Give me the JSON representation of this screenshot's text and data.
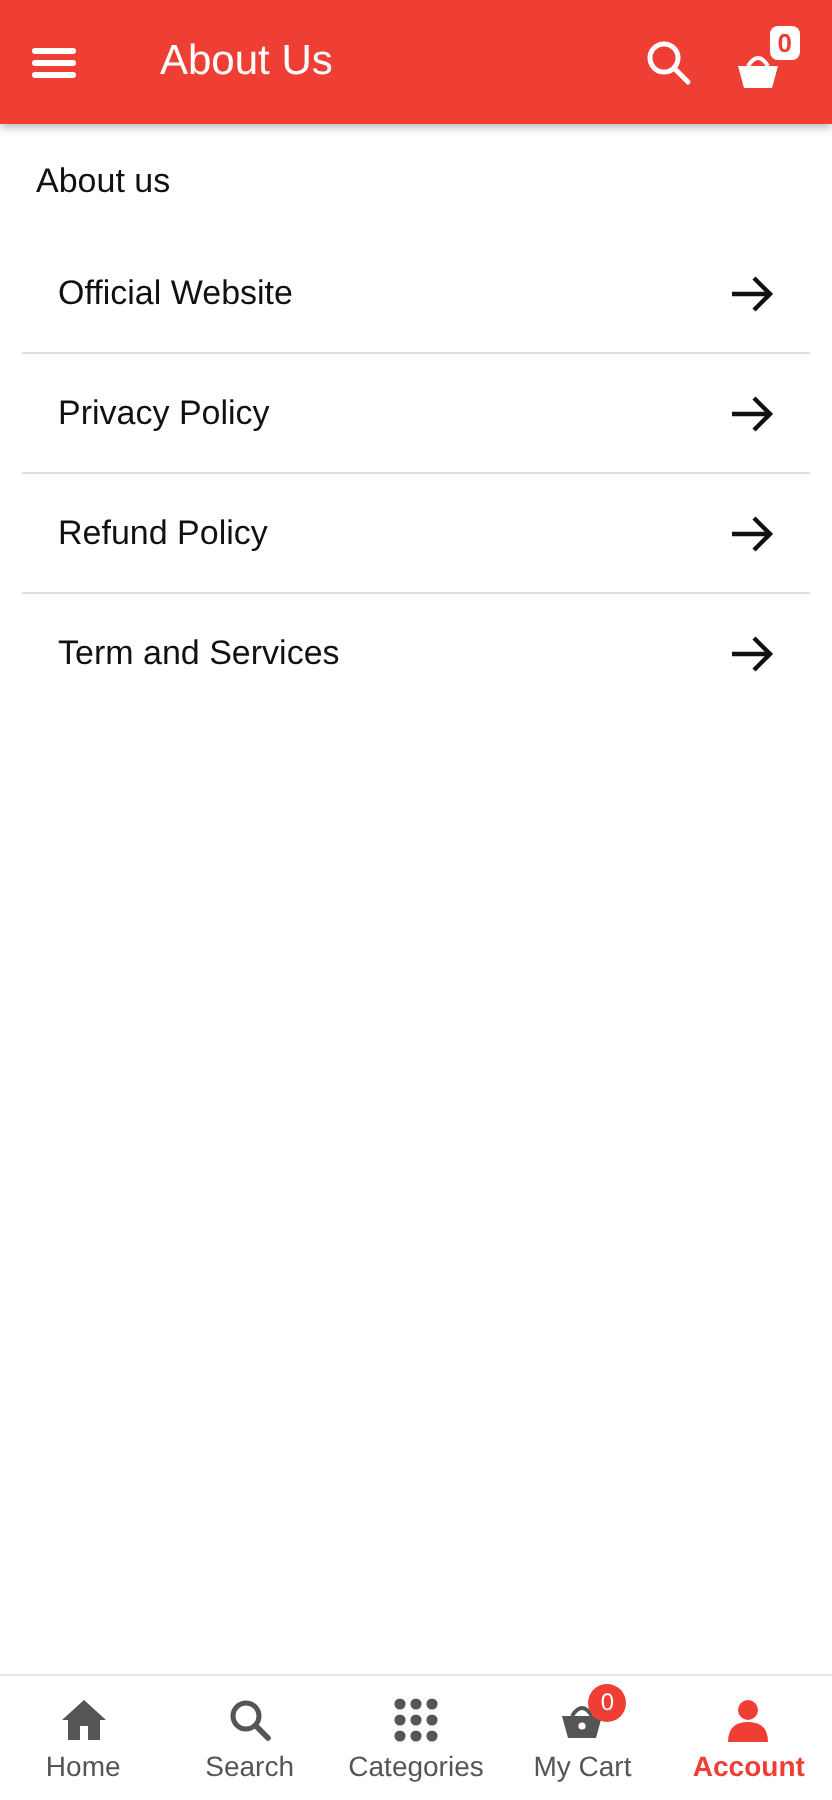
{
  "app_bar": {
    "title": "About Us",
    "cart_count": "0"
  },
  "section_title": "About us",
  "links": [
    {
      "label": "Official Website"
    },
    {
      "label": "Privacy Policy"
    },
    {
      "label": "Refund Policy"
    },
    {
      "label": "Term and Services"
    }
  ],
  "bottom_nav": [
    {
      "kind": "home",
      "label": "Home",
      "selected": false
    },
    {
      "kind": "search",
      "label": "Search",
      "selected": false
    },
    {
      "kind": "categories",
      "label": "Categories",
      "selected": false
    },
    {
      "kind": "cart",
      "label": "My Cart",
      "selected": false,
      "badge": "0"
    },
    {
      "kind": "account",
      "label": "Account",
      "selected": true
    }
  ]
}
